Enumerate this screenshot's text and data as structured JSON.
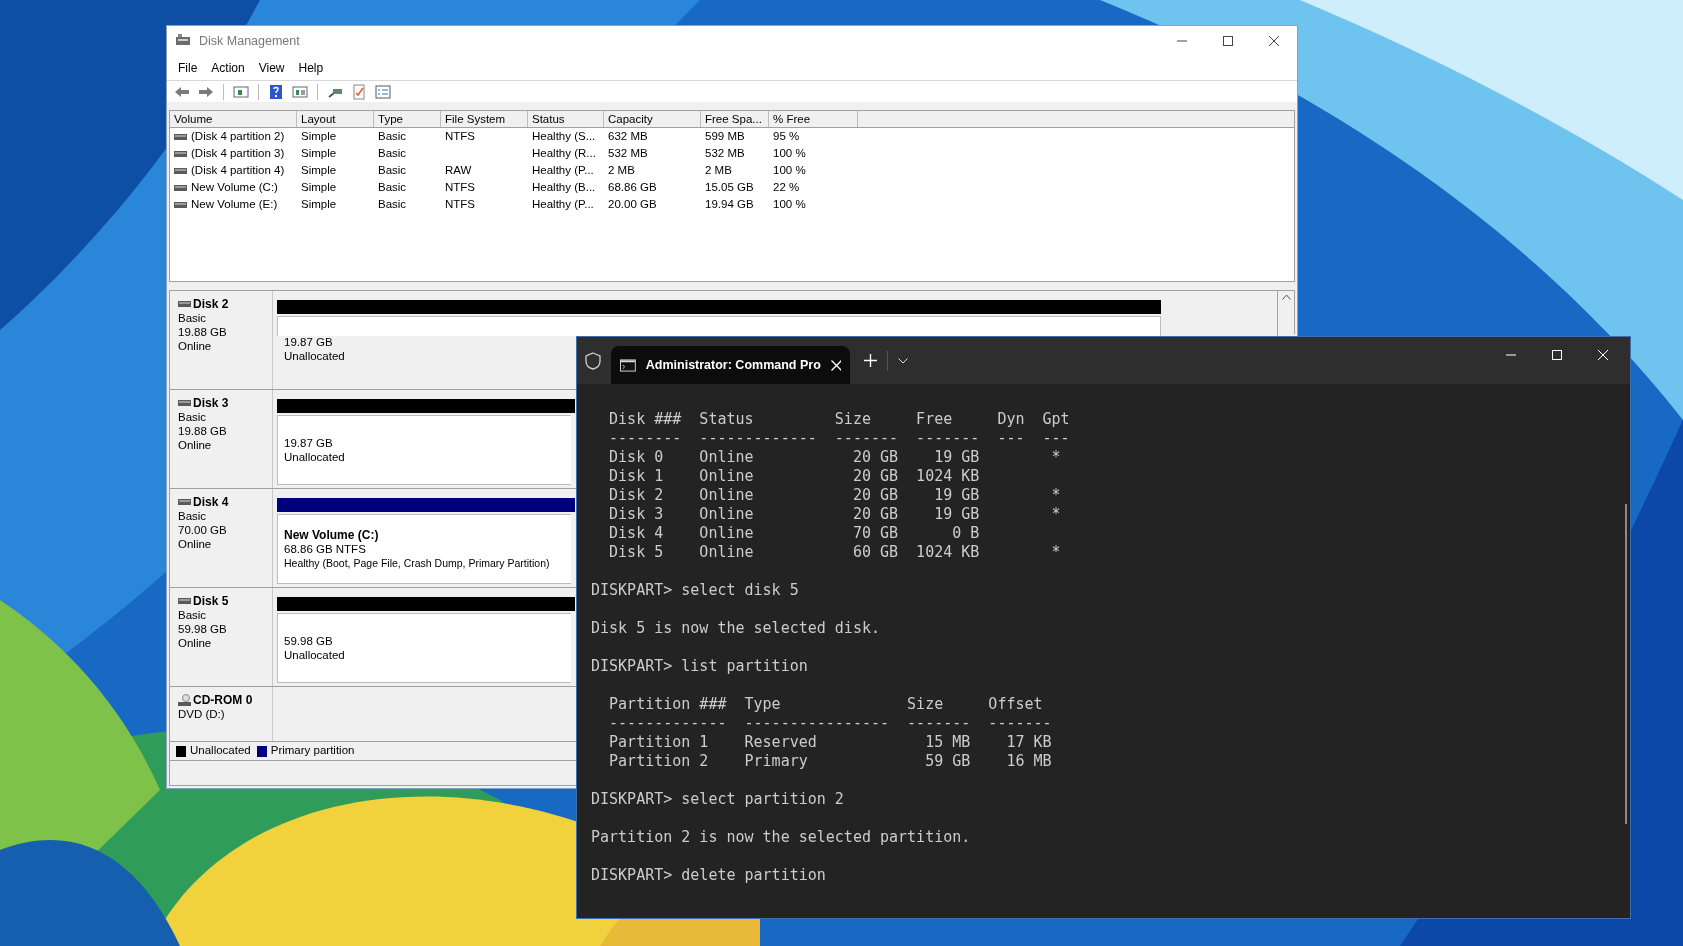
{
  "disk_management": {
    "title": "Disk Management",
    "menu": [
      "File",
      "Action",
      "View",
      "Help"
    ],
    "volume_table": {
      "columns": [
        "Volume",
        "Layout",
        "Type",
        "File System",
        "Status",
        "Capacity",
        "Free Spa...",
        "% Free"
      ],
      "rows": [
        {
          "volume": "(Disk 4 partition 2)",
          "layout": "Simple",
          "type": "Basic",
          "file_system": "NTFS",
          "status": "Healthy (S...",
          "capacity": "632 MB",
          "free_space": "599 MB",
          "percent_free": "95 %"
        },
        {
          "volume": "(Disk 4 partition 3)",
          "layout": "Simple",
          "type": "Basic",
          "status": "Healthy (R...",
          "capacity": "532 MB",
          "free_space": "532 MB",
          "percent_free": "100 %"
        },
        {
          "volume": "(Disk 4 partition 4)",
          "layout": "Simple",
          "type": "Basic",
          "file_system": "RAW",
          "status": "Healthy (P...",
          "capacity": "2 MB",
          "free_space": "2 MB",
          "percent_free": "100 %"
        },
        {
          "volume": "New Volume (C:)",
          "layout": "Simple",
          "type": "Basic",
          "file_system": "NTFS",
          "status": "Healthy (B...",
          "capacity": "68.86 GB",
          "free_space": "15.05 GB",
          "percent_free": "22 %"
        },
        {
          "volume": "New Volume (E:)",
          "layout": "Simple",
          "type": "Basic",
          "file_system": "NTFS",
          "status": "Healthy (P...",
          "capacity": "20.00 GB",
          "free_space": "19.94 GB",
          "percent_free": "100 %"
        }
      ]
    },
    "disks": [
      {
        "kind": "disk",
        "name": "Disk 2",
        "type": "Basic",
        "size": "19.88 GB",
        "state": "Online",
        "partition": {
          "kind": "unallocated",
          "size": "19.87 GB",
          "label": "Unallocated"
        }
      },
      {
        "kind": "disk",
        "name": "Disk 3",
        "type": "Basic",
        "size": "19.88 GB",
        "state": "Online",
        "partition": {
          "kind": "unallocated",
          "size": "19.87 GB",
          "label": "Unallocated"
        }
      },
      {
        "kind": "disk",
        "name": "Disk 4",
        "type": "Basic",
        "size": "70.00 GB",
        "state": "Online",
        "partition": {
          "kind": "primary",
          "name": "New Volume  (C:)",
          "size": "68.86 GB NTFS",
          "label": "Healthy (Boot, Page File, Crash Dump, Primary Partition)"
        }
      },
      {
        "kind": "disk",
        "name": "Disk 5",
        "type": "Basic",
        "size": "59.98 GB",
        "state": "Online",
        "partition": {
          "kind": "unallocated",
          "size": "59.98 GB",
          "label": "Unallocated"
        }
      },
      {
        "kind": "cdrom",
        "name": "CD-ROM 0",
        "type": "DVD (D:)"
      }
    ],
    "legend": [
      {
        "label": "Unallocated",
        "color": "#000000"
      },
      {
        "label": "Primary partition",
        "color": "#00007f"
      }
    ]
  },
  "terminal": {
    "tab_title": "Administrator: Command Pro",
    "blocks": [
      [
        "  Disk ###  Status         Size     Free     Dyn  Gpt",
        "  --------  -------------  -------  -------  ---  ---",
        "  Disk 0    Online           20 GB    19 GB        *",
        "  Disk 1    Online           20 GB  1024 KB",
        "  Disk 2    Online           20 GB    19 GB        *",
        "  Disk 3    Online           20 GB    19 GB        *",
        "  Disk 4    Online           70 GB      0 B",
        "  Disk 5    Online           60 GB  1024 KB        *"
      ],
      [
        "DISKPART> select disk 5"
      ],
      [
        "Disk 5 is now the selected disk."
      ],
      [
        "DISKPART> list partition"
      ],
      [
        "  Partition ###  Type              Size     Offset",
        "  -------------  ----------------  -------  -------",
        "  Partition 1    Reserved            15 MB    17 KB",
        "  Partition 2    Primary             59 GB    16 MB"
      ],
      [
        "DISKPART> select partition 2"
      ],
      [
        "Partition 2 is now the selected partition."
      ],
      [
        "DISKPART> delete partition"
      ]
    ]
  }
}
